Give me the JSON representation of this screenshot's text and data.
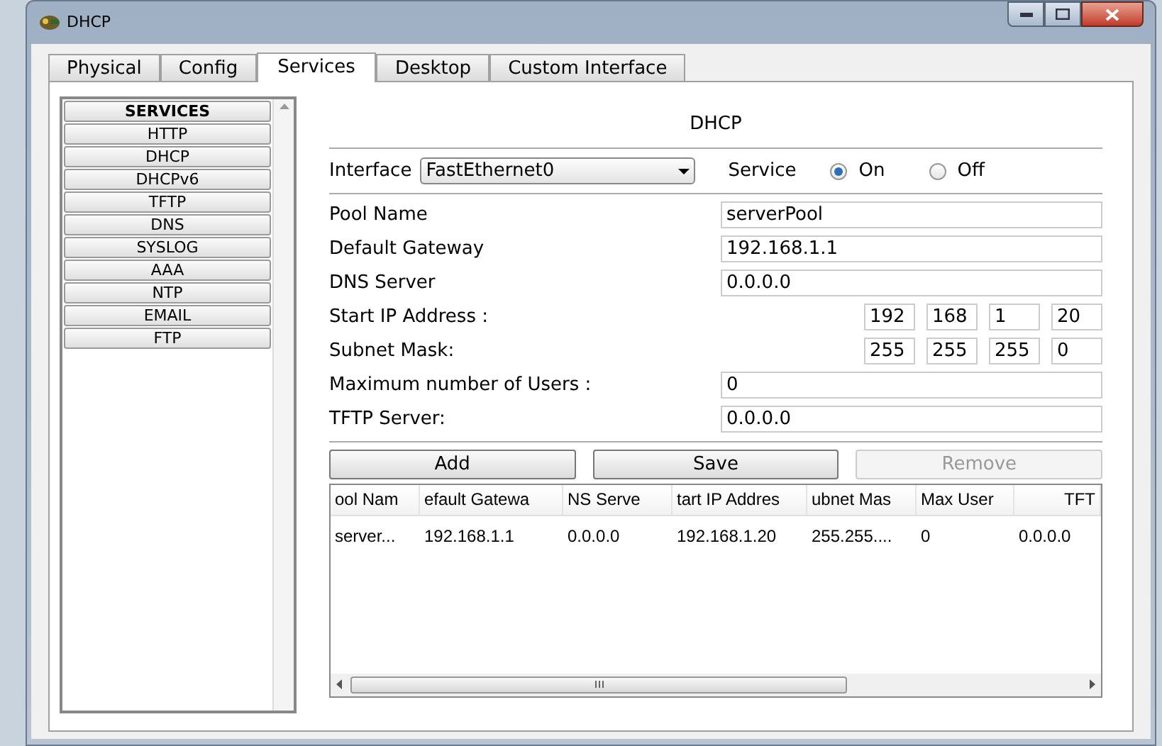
{
  "window": {
    "title": "DHCP"
  },
  "tabs": [
    {
      "label": "Physical",
      "selected": false
    },
    {
      "label": "Config",
      "selected": false
    },
    {
      "label": "Services",
      "selected": true
    },
    {
      "label": "Desktop",
      "selected": false
    },
    {
      "label": "Custom Interface",
      "selected": false
    }
  ],
  "sidebar": {
    "heading": "SERVICES",
    "items": [
      "HTTP",
      "DHCP",
      "DHCPv6",
      "TFTP",
      "DNS",
      "SYSLOG",
      "AAA",
      "NTP",
      "EMAIL",
      "FTP"
    ]
  },
  "panel_title": "DHCP",
  "interface": {
    "label": "Interface",
    "value": "FastEthernet0"
  },
  "service": {
    "label": "Service",
    "options": [
      {
        "label": "On",
        "selected": true
      },
      {
        "label": "Off",
        "selected": false
      }
    ]
  },
  "fields": [
    {
      "kind": "text",
      "label": "Pool Name",
      "value": "serverPool"
    },
    {
      "kind": "text",
      "label": "Default Gateway",
      "value": "192.168.1.1"
    },
    {
      "kind": "text",
      "label": "DNS Server",
      "value": "0.0.0.0"
    },
    {
      "kind": "octets",
      "label": "Start IP Address :",
      "octets": [
        "192",
        "168",
        "1",
        "20"
      ]
    },
    {
      "kind": "octets",
      "label": "Subnet Mask:",
      "octets": [
        "255",
        "255",
        "255",
        "0"
      ]
    },
    {
      "kind": "text",
      "label": "Maximum number of Users :",
      "value": "0"
    },
    {
      "kind": "text",
      "label": "TFTP Server:",
      "value": "0.0.0.0"
    }
  ],
  "buttons": [
    {
      "label": "Add",
      "disabled": false
    },
    {
      "label": "Save",
      "disabled": false
    },
    {
      "label": "Remove",
      "disabled": true
    }
  ],
  "table": {
    "columns": [
      "ool Nam",
      "efault Gatewa",
      "NS Serve",
      "tart IP Addres",
      "ubnet Mas",
      "Max User",
      "TFT"
    ],
    "rows": [
      [
        "server...",
        "192.168.1.1",
        "0.0.0.0",
        "192.168.1.20",
        "255.255....",
        "0",
        "0.0.0.0"
      ]
    ]
  }
}
